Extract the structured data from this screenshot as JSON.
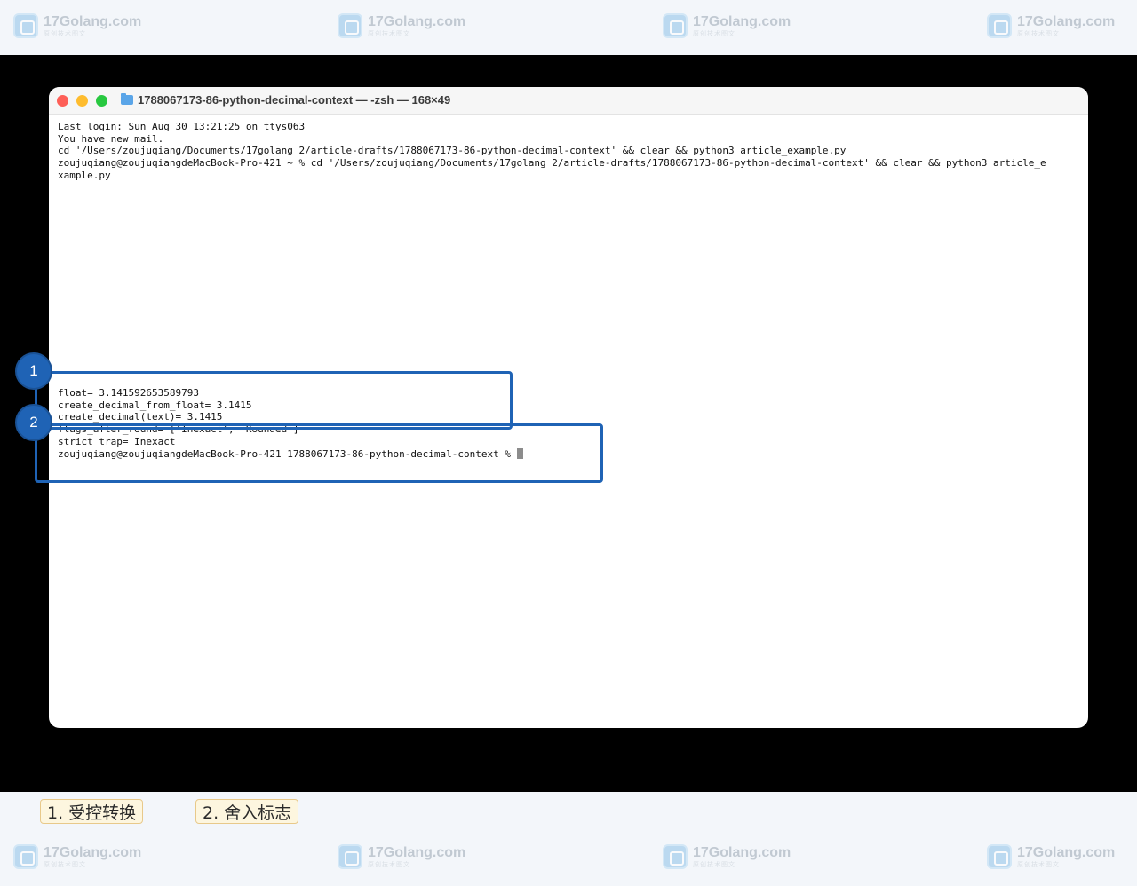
{
  "watermark": {
    "name": "17Golang.com",
    "sub": "原创技术图文"
  },
  "window": {
    "title": "1788067173-86-python-decimal-context — -zsh — 168×49"
  },
  "terminal": {
    "top_lines": "Last login: Sun Aug 30 13:21:25 on ttys063\nYou have new mail.\ncd '/Users/zoujuqiang/Documents/17golang 2/article-drafts/1788067173-86-python-decimal-context' && clear && python3 article_example.py\nzoujuqiang@zoujuqiangdeMacBook-Pro-421 ~ % cd '/Users/zoujuqiang/Documents/17golang 2/article-drafts/1788067173-86-python-decimal-context' && clear && python3 article_e\nxample.py",
    "output_lines": "float= 3.141592653589793\ncreate_decimal_from_float= 3.1415\ncreate_decimal(text)= 3.1415\nflags_after_round= ['Inexact', 'Rounded']\nstrict_trap= Inexact\nzoujuqiang@zoujuqiangdeMacBook-Pro-421 1788067173-86-python-decimal-context % "
  },
  "annotations": {
    "badge1": "1",
    "badge2": "2",
    "legend1": "1. 受控转换",
    "legend2": "2. 舍入标志",
    "color": "#1f63b5"
  }
}
